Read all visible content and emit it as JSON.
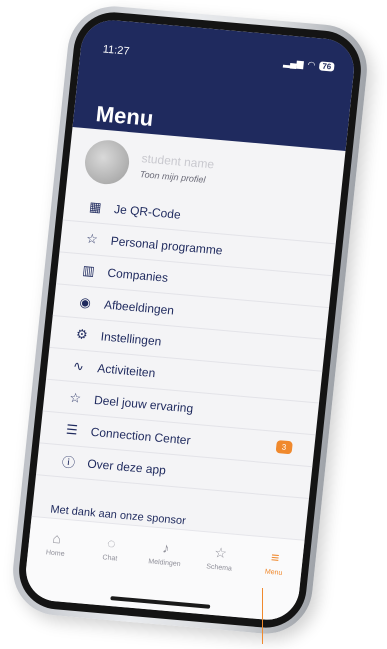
{
  "status": {
    "time": "11:27",
    "battery": "76"
  },
  "header": {
    "title": "Menu"
  },
  "profile": {
    "name": "student name",
    "subtitle": "Toon mijn profiel"
  },
  "menu": {
    "items": [
      {
        "label": "Je QR-Code",
        "icon": "qr-code-icon"
      },
      {
        "label": "Personal programme",
        "icon": "calendar-star-icon"
      },
      {
        "label": "Companies",
        "icon": "buildings-icon"
      },
      {
        "label": "Afbeeldingen",
        "icon": "camera-icon"
      },
      {
        "label": "Instellingen",
        "icon": "gears-icon"
      },
      {
        "label": "Activiteiten",
        "icon": "activity-icon"
      },
      {
        "label": "Deel jouw ervaring",
        "icon": "star-icon"
      },
      {
        "label": "Connection Center",
        "icon": "connection-icon",
        "badge": "3"
      },
      {
        "label": "Over deze app",
        "icon": "info-icon"
      }
    ],
    "sponsor": "Met dank aan onze sponsor"
  },
  "tabs": [
    {
      "label": "Home",
      "icon": "home-icon"
    },
    {
      "label": "Chat",
      "icon": "chat-icon"
    },
    {
      "label": "Meldingen",
      "icon": "bell-icon"
    },
    {
      "label": "Schema",
      "icon": "calendar-icon"
    },
    {
      "label": "Menu",
      "icon": "menu-icon",
      "active": true
    }
  ],
  "colors": {
    "primary": "#1f2a5e",
    "accent": "#f0892d"
  }
}
